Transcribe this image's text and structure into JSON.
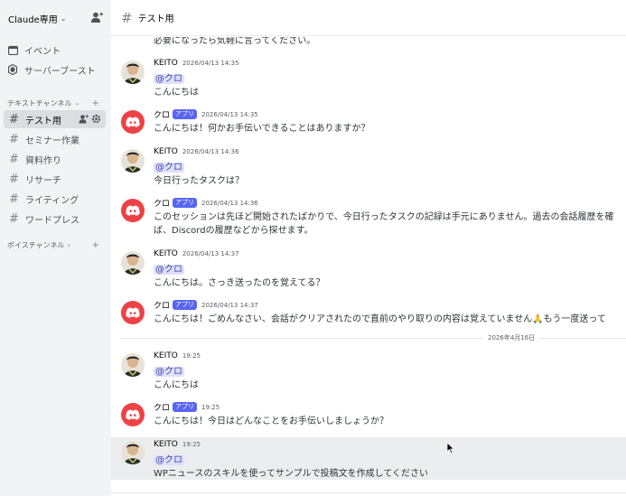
{
  "server": {
    "name": "Claude専用"
  },
  "sidebar": {
    "items": [
      {
        "label": "イベント",
        "icon": "calendar-icon"
      },
      {
        "label": "サーバーブースト",
        "icon": "boost-icon"
      }
    ],
    "text_section": "テキストチャンネル",
    "voice_section": "ボイスチャンネル",
    "channels": [
      {
        "label": "テスト用",
        "active": true
      },
      {
        "label": "セミナー作業"
      },
      {
        "label": "資料作り"
      },
      {
        "label": "リサーチ"
      },
      {
        "label": "ライティング"
      },
      {
        "label": "ワードプレス"
      }
    ]
  },
  "header": {
    "channel": "テスト用"
  },
  "messages": {
    "top_partial": "必要になったら気軽に言ってください。",
    "list": [
      {
        "author": "KEITO",
        "time": "2026/04/13 14:35",
        "mention": "@クロ",
        "text": "こんにちは"
      },
      {
        "author": "クロ",
        "badge": "アプリ",
        "time": "2026/04/13 14:35",
        "text": "こんにちは！何かお手伝いできることはありますか？"
      },
      {
        "author": "KEITO",
        "time": "2026/04/13 14:36",
        "mention": "@クロ",
        "text": "今日行ったタスクは？"
      },
      {
        "author": "クロ",
        "badge": "アプリ",
        "time": "2026/04/13 14:36",
        "text": "このセッションは先ほど開始されたばかりで、今日行ったタスクの記録は手元にありません。過去の会話履歴を確",
        "text2": "ば、Discordの履歴などから探せます。"
      },
      {
        "author": "KEITO",
        "time": "2026/04/13 14:37",
        "mention": "@クロ",
        "text": "こんにちは。さっき送ったのを覚えてる？"
      },
      {
        "author": "クロ",
        "badge": "アプリ",
        "time": "2026/04/13 14:37",
        "text": "こんにちは！ごめんなさい、会話がクリアされたので直前のやり取りの内容は覚えていません🙏もう一度送って"
      },
      {
        "author": "KEITO",
        "time": "19:25",
        "mention": "@クロ",
        "text": "こんにちは"
      },
      {
        "author": "クロ",
        "badge": "アプリ",
        "time": "19:25",
        "text": "こんにちは！今日はどんなことをお手伝いしましょうか？"
      },
      {
        "author": "KEITO",
        "time": "19:25",
        "mention": "@クロ",
        "text": "WPニュースのスキルを使ってサンプルで投稿文を作成してください"
      }
    ],
    "date_divider": "2026年4月16日"
  },
  "colors": {
    "accent": "#5865f2",
    "bot_avatar": "#ed4245",
    "mention_bg": "#dee0fc"
  }
}
